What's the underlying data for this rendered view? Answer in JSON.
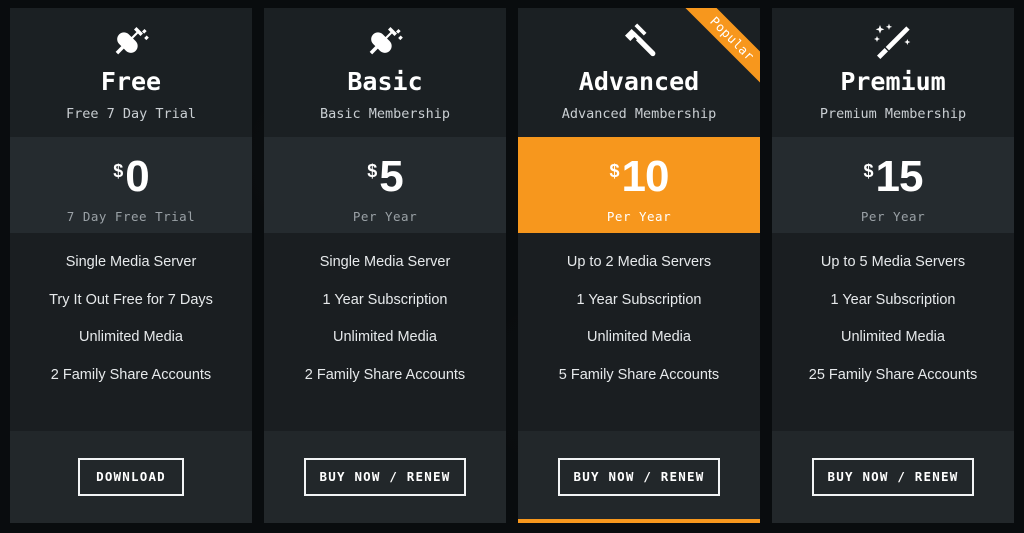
{
  "theme": {
    "accent": "#F7971D",
    "page_bg": "#090c0e",
    "card_bg": "#1a1f22",
    "header_bg": "#1b2023",
    "price_bg": "#252b2f",
    "footer_bg": "#22272a",
    "text": "#ffffff",
    "muted_text": "#9aa1a6"
  },
  "plans": [
    {
      "icon": "power-plug-icon",
      "title": "Free",
      "subtitle": "Free 7 Day Trial",
      "currency": "$",
      "amount": "0",
      "period": "7 Day Free Trial",
      "features": [
        "Single Media Server",
        "Try It Out Free for 7 Days",
        "Unlimited Media",
        "2 Family Share Accounts"
      ],
      "cta": "DOWNLOAD",
      "badge": null,
      "featured": false
    },
    {
      "icon": "power-plug-icon",
      "title": "Basic",
      "subtitle": "Basic Membership",
      "currency": "$",
      "amount": "5",
      "period": "Per Year",
      "features": [
        "Single Media Server",
        "1 Year Subscription",
        "Unlimited Media",
        "2 Family Share Accounts"
      ],
      "cta": "BUY NOW / RENEW",
      "badge": null,
      "featured": false
    },
    {
      "icon": "gavel-icon",
      "title": "Advanced",
      "subtitle": "Advanced Membership",
      "currency": "$",
      "amount": "10",
      "period": "Per Year",
      "features": [
        "Up to 2 Media Servers",
        "1 Year Subscription",
        "Unlimited Media",
        "5 Family Share Accounts"
      ],
      "cta": "BUY NOW / RENEW",
      "badge": "Popular",
      "featured": true
    },
    {
      "icon": "magic-wand-icon",
      "title": "Premium",
      "subtitle": "Premium Membership",
      "currency": "$",
      "amount": "15",
      "period": "Per Year",
      "features": [
        "Up to 5 Media Servers",
        "1 Year Subscription",
        "Unlimited Media",
        "25 Family Share Accounts"
      ],
      "cta": "BUY NOW / RENEW",
      "badge": null,
      "featured": false
    }
  ]
}
